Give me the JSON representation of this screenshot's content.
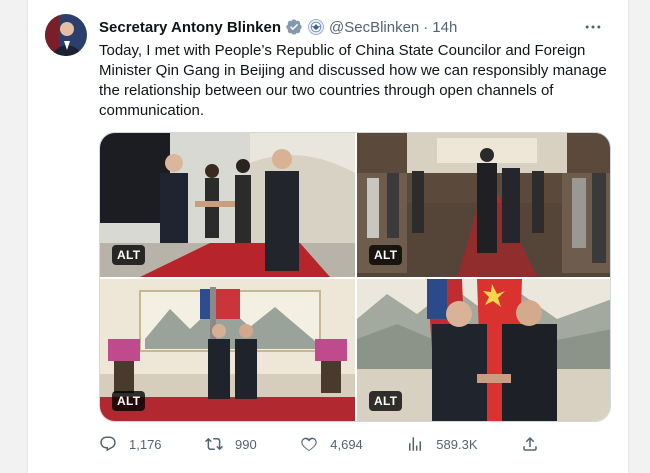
{
  "tweet": {
    "display_name": "Secretary Antony Blinken",
    "handle": "@SecBlinken",
    "separator": "·",
    "timestamp": "14h",
    "text": "Today, I met with People’s Republic of China State Councilor and Foreign Minister Qin Gang in Beijing and discussed how we can responsibly manage the relationship between our two countries through open channels of communication."
  },
  "media": {
    "images": [
      {
        "alt_label": "ALT"
      },
      {
        "alt_label": "ALT"
      },
      {
        "alt_label": "ALT"
      },
      {
        "alt_label": "ALT"
      }
    ]
  },
  "actions": {
    "replies": "1,176",
    "retweets": "990",
    "likes": "4,694",
    "views": "589.3K"
  },
  "icons": [
    "more-icon",
    "verified-icon",
    "government-seal-icon",
    "reply-icon",
    "retweet-icon",
    "like-icon",
    "views-icon",
    "share-icon"
  ],
  "colors": {
    "accent": "#1d9bf0",
    "text_primary": "#0f1419",
    "text_secondary": "#536471",
    "verified_badge": "#829aab"
  }
}
